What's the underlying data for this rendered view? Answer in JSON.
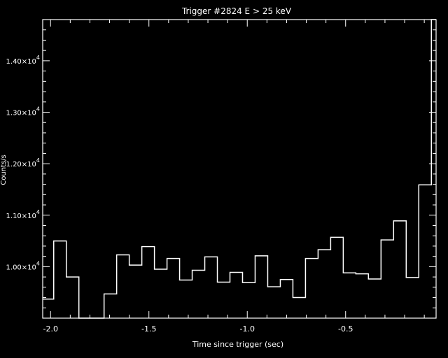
{
  "chart_data": {
    "type": "line",
    "title": "Trigger #2824 E > 25 keV",
    "xlabel": "Time since trigger (sec)",
    "ylabel": "Counts/s",
    "xlim": [
      -2.04,
      -0.04
    ],
    "ylim": [
      9000,
      14800
    ],
    "x_ticks": [
      {
        "value": -2.0,
        "label": "-2.0"
      },
      {
        "value": -1.5,
        "label": "-1.5"
      },
      {
        "value": -1.0,
        "label": "-1.0"
      },
      {
        "value": -0.5,
        "label": "-0.5"
      }
    ],
    "y_ticks": [
      {
        "value": 10000,
        "mantissa": "1.00",
        "times": "×10",
        "exponent": "4"
      },
      {
        "value": 11000,
        "mantissa": "1.10",
        "times": "×10",
        "exponent": "4"
      },
      {
        "value": 12000,
        "mantissa": "1.20",
        "times": "×10",
        "exponent": "4"
      },
      {
        "value": 13000,
        "mantissa": "1.30",
        "times": "×10",
        "exponent": "4"
      },
      {
        "value": 14000,
        "mantissa": "1.40",
        "times": "×10",
        "exponent": "4"
      }
    ],
    "grid": false,
    "bin_width": 0.064,
    "bin_starts": [
      -2.048,
      -1.984,
      -1.92,
      -1.856,
      -1.792,
      -1.728,
      -1.664,
      -1.6,
      -1.536,
      -1.472,
      -1.408,
      -1.344,
      -1.28,
      -1.216,
      -1.152,
      -1.088,
      -1.024,
      -0.96,
      -0.896,
      -0.832,
      -0.768,
      -0.704,
      -0.64,
      -0.576,
      -0.512,
      -0.448,
      -0.384,
      -0.32,
      -0.256,
      -0.192,
      -0.128,
      -0.064
    ],
    "values": [
      9370,
      10500,
      9800,
      8500,
      8500,
      9470,
      10230,
      10030,
      10390,
      9950,
      10160,
      9740,
      9930,
      10190,
      9700,
      9890,
      9690,
      10210,
      9610,
      9750,
      9400,
      10160,
      10330,
      10570,
      9880,
      9860,
      9760,
      10520,
      10890,
      9790,
      11590,
      14800
    ]
  }
}
